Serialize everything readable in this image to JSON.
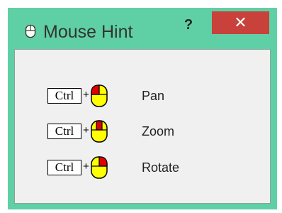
{
  "window": {
    "title": "Mouse Hint",
    "icon": "mouse-icon",
    "help_label": "?",
    "close_label": "✕",
    "colors": {
      "frame": "#5fd0a5",
      "close": "#c8413a",
      "client": "#f0f0f0"
    }
  },
  "hints": [
    {
      "key": "Ctrl",
      "plus": "+",
      "button": "left",
      "action": "Pan"
    },
    {
      "key": "Ctrl",
      "plus": "+",
      "button": "middle",
      "action": "Zoom"
    },
    {
      "key": "Ctrl",
      "plus": "+",
      "button": "right",
      "action": "Rotate"
    }
  ],
  "mouse_colors": {
    "body": "#ffff00",
    "pressed": "#e00000",
    "outline": "#000000"
  }
}
